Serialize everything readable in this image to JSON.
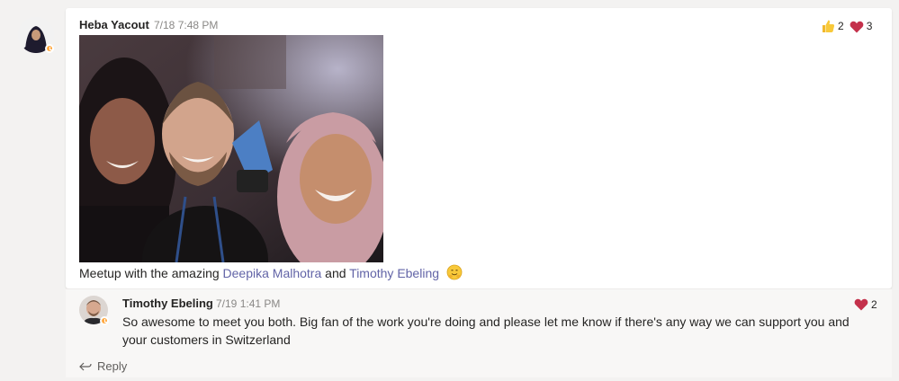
{
  "post": {
    "author": "Heba Yacout",
    "timestamp": "7/18 7:48 PM",
    "message_prefix": "Meetup with the amazing ",
    "mention_1": "Deepika Malhotra",
    "message_and": " and ",
    "mention_2": "Timothy Ebeling",
    "emoji_icon": "hugging-face-icon",
    "reactions": [
      {
        "icon": "thumbs-up-icon",
        "count": "2"
      },
      {
        "icon": "heart-icon",
        "count": "3"
      }
    ]
  },
  "reply": {
    "author": "Timothy Ebeling",
    "timestamp": "7/19 1:41 PM",
    "message": "So awesome to meet you both. Big fan of the work you're doing and please let me know if there's any way we can support you and your customers in Switzerland",
    "reactions": [
      {
        "icon": "heart-icon",
        "count": "2"
      }
    ]
  },
  "reply_button": {
    "label": "Reply",
    "icon": "reply-arrow-icon"
  },
  "colors": {
    "mention": "#6264a7",
    "heart": "#c4314b",
    "away_status": "#ffaa44"
  }
}
